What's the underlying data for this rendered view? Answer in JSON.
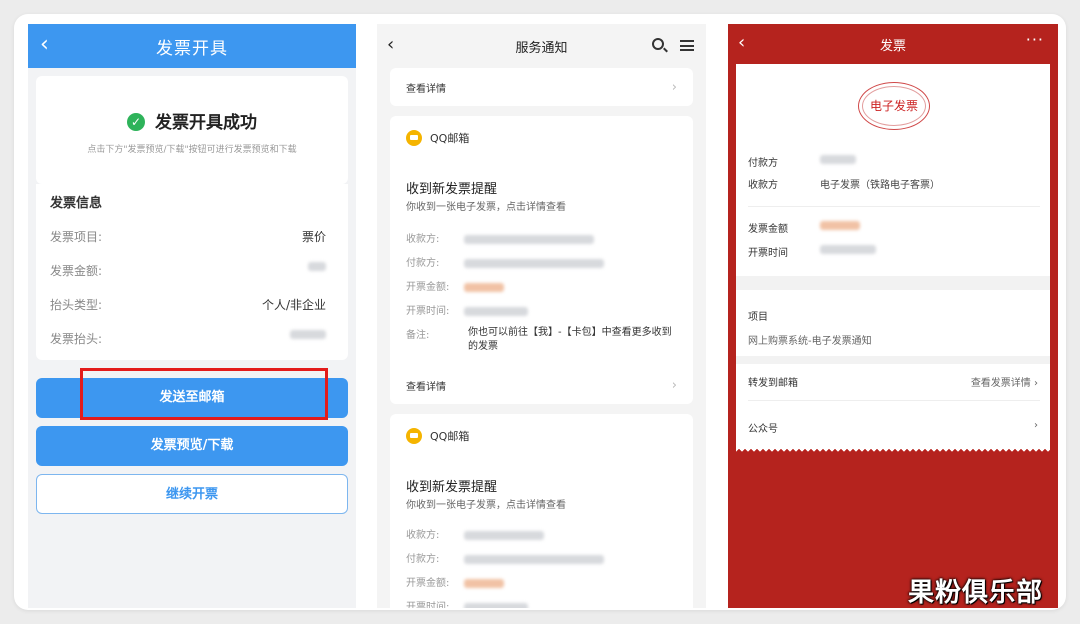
{
  "panel1": {
    "title": "发票开具",
    "success": "发票开具成功",
    "hint": "点击下方\"发票预览/下载\"按钮可进行发票预览和下载",
    "section": "发票信息",
    "rows": [
      {
        "label": "发票项目:",
        "value": "票价"
      },
      {
        "label": "发票金额:",
        "value": ""
      },
      {
        "label": "抬头类型:",
        "value": "个人/非企业"
      },
      {
        "label": "发票抬头:",
        "value": ""
      }
    ],
    "buttons": {
      "send": "发送至邮箱",
      "preview": "发票预览/下载",
      "continue": "继续开票"
    }
  },
  "panel2": {
    "title": "服务通知",
    "view_detail": "查看详情",
    "cards": [
      {
        "sender": "QQ邮箱",
        "title": "收到新发票提醒",
        "subtitle": "你收到一张电子发票，点击详情查看",
        "payee": "收款方:",
        "payer": "付款方:",
        "amount": "开票金额:",
        "time": "开票时间:",
        "note_label": "备注:",
        "note": "你也可以前往【我】-【卡包】中查看更多收到的发票",
        "view_detail": "查看详情"
      },
      {
        "sender": "QQ邮箱",
        "title": "收到新发票提醒",
        "subtitle": "你收到一张电子发票，点击详情查看",
        "payee": "收款方:",
        "payer": "付款方:",
        "amount": "开票金额:",
        "time": "开票时间:"
      }
    ]
  },
  "panel3": {
    "title": "发票",
    "more": "···",
    "stamp": "电子发票",
    "payer_label": "付款方",
    "payee_label": "收款方",
    "payee_value": "电子发票（铁路电子客票）",
    "amount_label": "发票金额",
    "time_label": "开票时间",
    "item_label": "项目",
    "item_value": "网上购票系统-电子发票通知",
    "forward": "转发到邮箱",
    "view_invoice": "查看发票详情",
    "official": "公众号"
  },
  "watermark": "果粉俱乐部"
}
